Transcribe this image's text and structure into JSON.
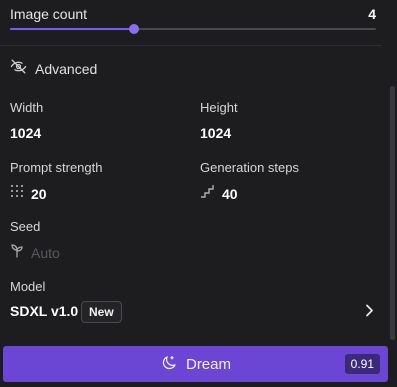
{
  "image_count": {
    "label": "Image count",
    "value": "4",
    "slider_fraction": 0.34
  },
  "advanced": {
    "label": "Advanced",
    "icon": "eye-off-icon"
  },
  "width": {
    "label": "Width",
    "value": "1024"
  },
  "height": {
    "label": "Height",
    "value": "1024"
  },
  "prompt_strength": {
    "label": "Prompt strength",
    "value": "20",
    "icon": "grid-dots-icon"
  },
  "generation_steps": {
    "label": "Generation steps",
    "value": "40",
    "icon": "stairs-icon"
  },
  "seed": {
    "label": "Seed",
    "placeholder": "Auto",
    "icon": "sprout-icon"
  },
  "model": {
    "label": "Model",
    "value": "SDXL v1.0",
    "badge": "New",
    "icon": "chevron-right-icon"
  },
  "dream_button": {
    "label": "Dream",
    "cost": "0.91",
    "icon": "moon-sparkle-icon"
  },
  "colors": {
    "accent": "#6b46d4",
    "background": "#1d1d1f",
    "slider": "#7a5cf0"
  }
}
